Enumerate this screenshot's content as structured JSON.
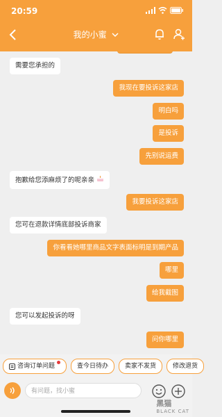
{
  "status_bar": {
    "time": "20:59"
  },
  "header": {
    "title": "我的小蜜"
  },
  "messages": [
    {
      "side": "left",
      "text": "需要您承担的"
    },
    {
      "side": "right",
      "text": "我现在要投诉这家店"
    },
    {
      "side": "right",
      "text": "明白吗"
    },
    {
      "side": "right",
      "text": "是投诉"
    },
    {
      "side": "right",
      "text": "先别说运费"
    },
    {
      "side": "left",
      "text": "抱歉给您添麻烦了的呢亲亲"
    },
    {
      "side": "right",
      "text": "我要投诉这家店"
    },
    {
      "side": "left",
      "text": "您可在退款详情底部投诉商家"
    },
    {
      "side": "right",
      "text": "你看看她哪里商品文字表面标明是到期产品"
    },
    {
      "side": "right",
      "text": "哪里"
    },
    {
      "side": "right",
      "text": "给我截图"
    },
    {
      "side": "left",
      "text": "您可以发起投诉的呀"
    },
    {
      "side": "right",
      "text": "问你哪里"
    }
  ],
  "quick_actions": [
    {
      "label": "咨询订单问题"
    },
    {
      "label": "查今日待办"
    },
    {
      "label": "卖家不发货"
    },
    {
      "label": "修改退货"
    }
  ],
  "input": {
    "placeholder": "有问题，找小蜜"
  },
  "watermark": {
    "main": "黑猫",
    "sub": "BLACK CAT"
  }
}
